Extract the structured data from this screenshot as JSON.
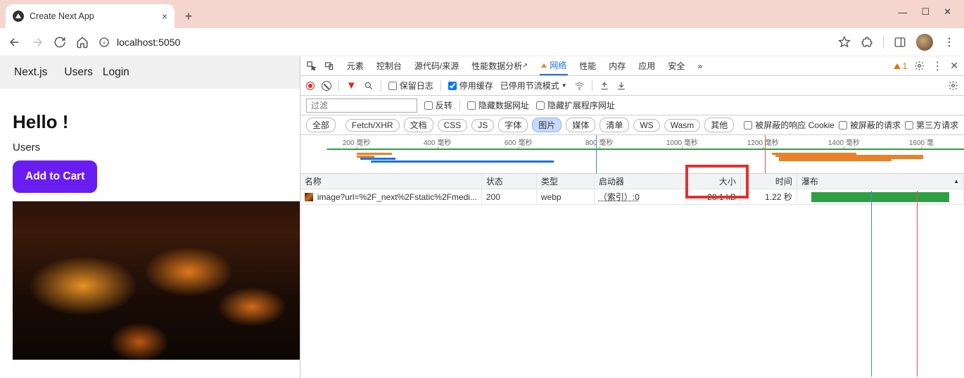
{
  "browser": {
    "tab_title": "Create Next App",
    "url_text": "localhost:5050",
    "url_host": "localhost",
    "warning_count": "1"
  },
  "page": {
    "nav": {
      "brand": "Next.js",
      "link1": "Users",
      "link2": "Login"
    },
    "heading": "Hello !",
    "users_label": "Users",
    "cart_button": "Add to Cart"
  },
  "devtools": {
    "tabs": {
      "elements": "元素",
      "console": "控制台",
      "sources": "源代码/来源",
      "performance": "性能数据分析",
      "network": "网络",
      "perf2": "性能",
      "memory": "内存",
      "application": "应用",
      "security": "安全",
      "more": "»"
    },
    "controls": {
      "preserve_log": "保留日志",
      "disable_cache": "停用缓存",
      "throttling": "已停用节流模式"
    },
    "filter_placeholder": "过滤",
    "filter_row3": {
      "invert": "反转",
      "hide_data": "隐藏数据网址",
      "hide_ext": "隐藏扩展程序网址"
    },
    "type_pills": {
      "all": "全部",
      "fetch": "Fetch/XHR",
      "doc": "文档",
      "css": "CSS",
      "js": "JS",
      "font": "字体",
      "img": "图片",
      "media": "媒体",
      "manifest": "清单",
      "ws": "WS",
      "wasm": "Wasm",
      "other": "其他"
    },
    "extra_filters": {
      "blocked_cookies": "被屏蔽的响应 Cookie",
      "blocked_req": "被屏蔽的请求",
      "third_party": "第三方请求"
    },
    "timeline_ticks": [
      "200 毫秒",
      "400 毫秒",
      "600 毫秒",
      "800 毫秒",
      "1000 毫秒",
      "1200 毫秒",
      "1400 毫秒",
      "1600 毫"
    ],
    "columns": {
      "name": "名称",
      "status": "状态",
      "type": "类型",
      "initiator": "启动器",
      "size": "大小",
      "time": "时间",
      "waterfall": "瀑布"
    },
    "rows": [
      {
        "name": "image?url=%2F_next%2Fstatic%2Fmedi...",
        "status": "200",
        "type": "webp",
        "initiator": "（索引）:0",
        "size": "28.1 kB",
        "time": "1.22 秒"
      }
    ]
  }
}
